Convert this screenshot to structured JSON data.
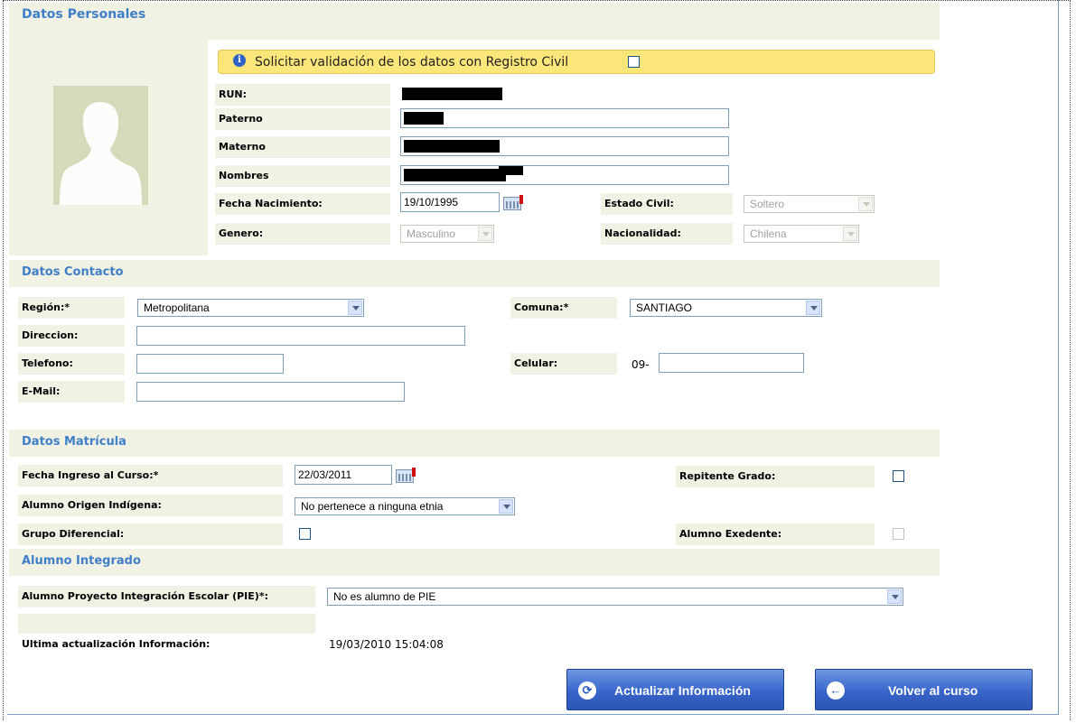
{
  "sections": {
    "personales": "Datos Personales",
    "contacto": "Datos Contacto",
    "matricula": "Datos Matrícula",
    "integrado": "Alumno Integrado"
  },
  "personales": {
    "validacion_text": "Solicitar validación de los datos con Registro Civil",
    "run_label": "RUN:",
    "paterno_label": "Paterno",
    "materno_label": "Materno",
    "nombres_label": "Nombres",
    "fecha_nac_label": "Fecha Nacimiento:",
    "fecha_nac_value": "19/10/1995",
    "genero_label": "Genero:",
    "genero_value": "Masculino",
    "estado_civil_label": "Estado Civil:",
    "estado_civil_value": "Soltero",
    "nacionalidad_label": "Nacionalidad:",
    "nacionalidad_value": "Chilena"
  },
  "contacto": {
    "region_label": "Región:*",
    "region_value": "Metropolitana",
    "comuna_label": "Comuna:*",
    "comuna_value": "SANTIAGO",
    "direccion_label": "Direccion:",
    "telefono_label": "Telefono:",
    "celular_label": "Celular:",
    "celular_prefix": "09-",
    "email_label": "E-Mail:"
  },
  "matricula": {
    "fecha_ingreso_label": "Fecha Ingreso al Curso:*",
    "fecha_ingreso_value": "22/03/2011",
    "repitente_label": "Repitente Grado:",
    "origen_label": "Alumno Origen Indígena:",
    "origen_value": "No pertenece a ninguna etnia",
    "diferencial_label": "Grupo Diferencial:",
    "exedente_label": "Alumno Exedente:"
  },
  "integrado": {
    "pie_label": "Alumno Proyecto Integración Escolar (PIE)*:",
    "pie_value": "No es alumno de PIE",
    "ultima_label": "Ultima actualización Información:",
    "ultima_value": "19/03/2010 15:04:08"
  },
  "buttons": {
    "actualizar": "Actualizar Información",
    "volver": "Volver al curso"
  },
  "colors": {
    "section_title": "#3f7fc8",
    "label_bg": "#f1f1e4",
    "notice_bg": "#fbe67a",
    "button": "#3865c9"
  }
}
